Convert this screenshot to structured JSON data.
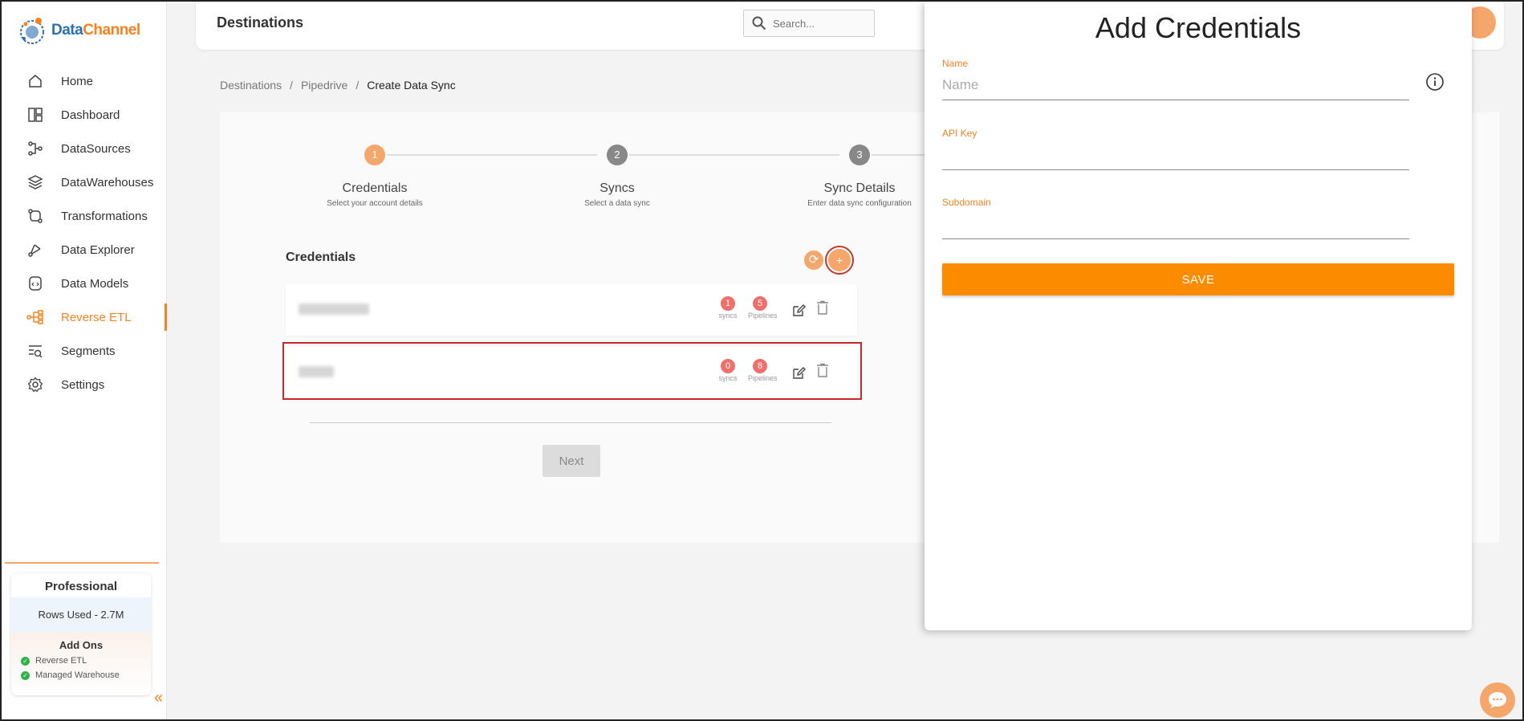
{
  "brand": {
    "part1": "Data",
    "part2": "Channel"
  },
  "sidebar": {
    "items": [
      {
        "label": "Home",
        "icon": "home-icon"
      },
      {
        "label": "Dashboard",
        "icon": "dashboard-icon"
      },
      {
        "label": "DataSources",
        "icon": "datasources-icon"
      },
      {
        "label": "DataWarehouses",
        "icon": "datawarehouses-icon"
      },
      {
        "label": "Transformations",
        "icon": "transformations-icon"
      },
      {
        "label": "Data Explorer",
        "icon": "data-explorer-icon"
      },
      {
        "label": "Data Models",
        "icon": "data-models-icon"
      },
      {
        "label": "Reverse ETL",
        "icon": "reverse-etl-icon",
        "active": true
      },
      {
        "label": "Segments",
        "icon": "segments-icon"
      },
      {
        "label": "Settings",
        "icon": "gear-icon"
      }
    ],
    "plan": {
      "title": "Professional",
      "rows_used": "Rows Used - 2.7M",
      "addons_title": "Add Ons",
      "addons": [
        "Reverse ETL",
        "Managed Warehouse"
      ]
    }
  },
  "header": {
    "title": "Destinations",
    "search_placeholder": "Search..."
  },
  "breadcrumb": {
    "items": [
      "Destinations",
      "Pipedrive",
      "Create Data Sync"
    ],
    "separator": "/"
  },
  "stepper": {
    "steps": [
      {
        "number": "1",
        "label": "Credentials",
        "sub": "Select your account details",
        "active": true
      },
      {
        "number": "2",
        "label": "Syncs",
        "sub": "Select a data sync"
      },
      {
        "number": "3",
        "label": "Sync Details",
        "sub": "Enter data sync configuration"
      }
    ]
  },
  "credentials": {
    "title": "Credentials",
    "add_label": "+",
    "rows": [
      {
        "syncs": "1",
        "syncs_label": "syncs",
        "pipelines": "5",
        "pipelines_label": "Pipelines"
      },
      {
        "syncs": "0",
        "syncs_label": "syncs",
        "pipelines": "8",
        "pipelines_label": "Pipelines"
      }
    ],
    "next_label": "Next"
  },
  "drawer": {
    "title": "Add Credentials",
    "fields": [
      {
        "label": "Name",
        "placeholder": "Name",
        "value": ""
      },
      {
        "label": "API Key",
        "placeholder": "",
        "value": ""
      },
      {
        "label": "Subdomain",
        "placeholder": "",
        "value": ""
      }
    ],
    "save_label": "SAVE"
  },
  "colors": {
    "accent": "#f58220",
    "save": "#fb8c00",
    "badge": "#ef6f6c",
    "highlight": "#c62828"
  }
}
